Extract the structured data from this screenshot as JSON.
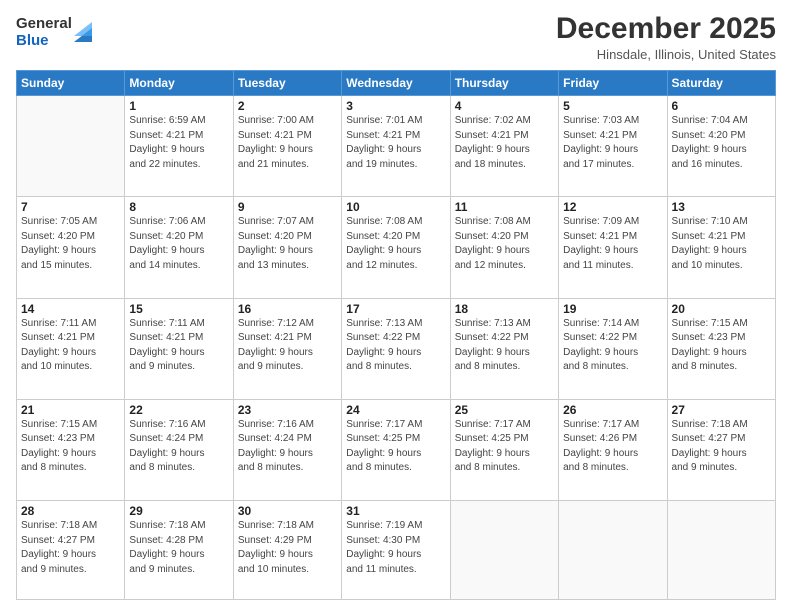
{
  "header": {
    "logo_general": "General",
    "logo_blue": "Blue",
    "title": "December 2025",
    "subtitle": "Hinsdale, Illinois, United States"
  },
  "days_of_week": [
    "Sunday",
    "Monday",
    "Tuesday",
    "Wednesday",
    "Thursday",
    "Friday",
    "Saturday"
  ],
  "weeks": [
    [
      {
        "day": "",
        "info": ""
      },
      {
        "day": "1",
        "info": "Sunrise: 6:59 AM\nSunset: 4:21 PM\nDaylight: 9 hours\nand 22 minutes."
      },
      {
        "day": "2",
        "info": "Sunrise: 7:00 AM\nSunset: 4:21 PM\nDaylight: 9 hours\nand 21 minutes."
      },
      {
        "day": "3",
        "info": "Sunrise: 7:01 AM\nSunset: 4:21 PM\nDaylight: 9 hours\nand 19 minutes."
      },
      {
        "day": "4",
        "info": "Sunrise: 7:02 AM\nSunset: 4:21 PM\nDaylight: 9 hours\nand 18 minutes."
      },
      {
        "day": "5",
        "info": "Sunrise: 7:03 AM\nSunset: 4:21 PM\nDaylight: 9 hours\nand 17 minutes."
      },
      {
        "day": "6",
        "info": "Sunrise: 7:04 AM\nSunset: 4:20 PM\nDaylight: 9 hours\nand 16 minutes."
      }
    ],
    [
      {
        "day": "7",
        "info": "Sunrise: 7:05 AM\nSunset: 4:20 PM\nDaylight: 9 hours\nand 15 minutes."
      },
      {
        "day": "8",
        "info": "Sunrise: 7:06 AM\nSunset: 4:20 PM\nDaylight: 9 hours\nand 14 minutes."
      },
      {
        "day": "9",
        "info": "Sunrise: 7:07 AM\nSunset: 4:20 PM\nDaylight: 9 hours\nand 13 minutes."
      },
      {
        "day": "10",
        "info": "Sunrise: 7:08 AM\nSunset: 4:20 PM\nDaylight: 9 hours\nand 12 minutes."
      },
      {
        "day": "11",
        "info": "Sunrise: 7:08 AM\nSunset: 4:20 PM\nDaylight: 9 hours\nand 12 minutes."
      },
      {
        "day": "12",
        "info": "Sunrise: 7:09 AM\nSunset: 4:21 PM\nDaylight: 9 hours\nand 11 minutes."
      },
      {
        "day": "13",
        "info": "Sunrise: 7:10 AM\nSunset: 4:21 PM\nDaylight: 9 hours\nand 10 minutes."
      }
    ],
    [
      {
        "day": "14",
        "info": "Sunrise: 7:11 AM\nSunset: 4:21 PM\nDaylight: 9 hours\nand 10 minutes."
      },
      {
        "day": "15",
        "info": "Sunrise: 7:11 AM\nSunset: 4:21 PM\nDaylight: 9 hours\nand 9 minutes."
      },
      {
        "day": "16",
        "info": "Sunrise: 7:12 AM\nSunset: 4:21 PM\nDaylight: 9 hours\nand 9 minutes."
      },
      {
        "day": "17",
        "info": "Sunrise: 7:13 AM\nSunset: 4:22 PM\nDaylight: 9 hours\nand 8 minutes."
      },
      {
        "day": "18",
        "info": "Sunrise: 7:13 AM\nSunset: 4:22 PM\nDaylight: 9 hours\nand 8 minutes."
      },
      {
        "day": "19",
        "info": "Sunrise: 7:14 AM\nSunset: 4:22 PM\nDaylight: 9 hours\nand 8 minutes."
      },
      {
        "day": "20",
        "info": "Sunrise: 7:15 AM\nSunset: 4:23 PM\nDaylight: 9 hours\nand 8 minutes."
      }
    ],
    [
      {
        "day": "21",
        "info": "Sunrise: 7:15 AM\nSunset: 4:23 PM\nDaylight: 9 hours\nand 8 minutes."
      },
      {
        "day": "22",
        "info": "Sunrise: 7:16 AM\nSunset: 4:24 PM\nDaylight: 9 hours\nand 8 minutes."
      },
      {
        "day": "23",
        "info": "Sunrise: 7:16 AM\nSunset: 4:24 PM\nDaylight: 9 hours\nand 8 minutes."
      },
      {
        "day": "24",
        "info": "Sunrise: 7:17 AM\nSunset: 4:25 PM\nDaylight: 9 hours\nand 8 minutes."
      },
      {
        "day": "25",
        "info": "Sunrise: 7:17 AM\nSunset: 4:25 PM\nDaylight: 9 hours\nand 8 minutes."
      },
      {
        "day": "26",
        "info": "Sunrise: 7:17 AM\nSunset: 4:26 PM\nDaylight: 9 hours\nand 8 minutes."
      },
      {
        "day": "27",
        "info": "Sunrise: 7:18 AM\nSunset: 4:27 PM\nDaylight: 9 hours\nand 9 minutes."
      }
    ],
    [
      {
        "day": "28",
        "info": "Sunrise: 7:18 AM\nSunset: 4:27 PM\nDaylight: 9 hours\nand 9 minutes."
      },
      {
        "day": "29",
        "info": "Sunrise: 7:18 AM\nSunset: 4:28 PM\nDaylight: 9 hours\nand 9 minutes."
      },
      {
        "day": "30",
        "info": "Sunrise: 7:18 AM\nSunset: 4:29 PM\nDaylight: 9 hours\nand 10 minutes."
      },
      {
        "day": "31",
        "info": "Sunrise: 7:19 AM\nSunset: 4:30 PM\nDaylight: 9 hours\nand 11 minutes."
      },
      {
        "day": "",
        "info": ""
      },
      {
        "day": "",
        "info": ""
      },
      {
        "day": "",
        "info": ""
      }
    ]
  ]
}
